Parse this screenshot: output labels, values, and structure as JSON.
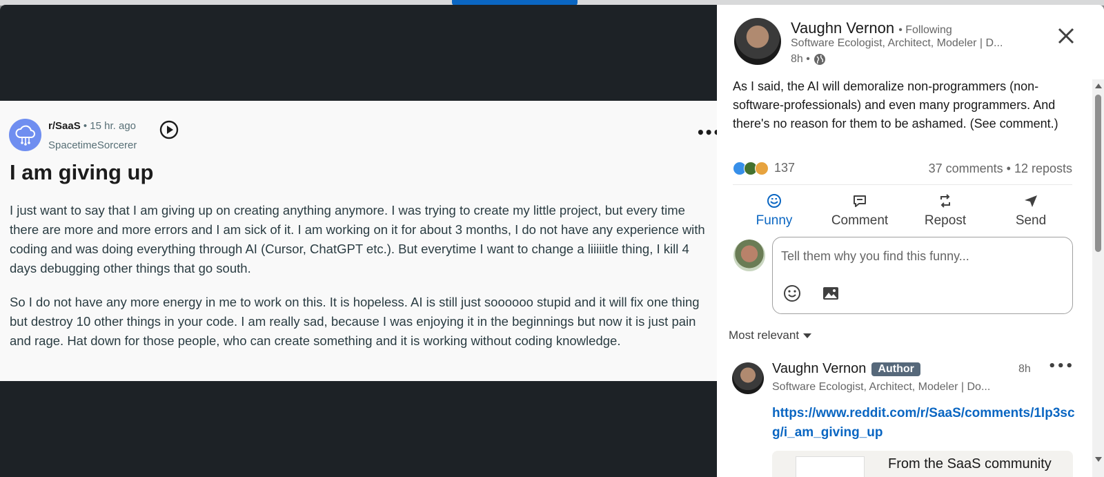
{
  "reddit_post": {
    "subreddit": "r/SaaS",
    "time": "• 15 hr. ago",
    "username": "SpacetimeSorcerer",
    "title": "I am giving up",
    "paragraph_1": "I just want to say that I am giving up on creating anything anymore. I was trying to create my little project, but every time there are more and more errors and I am sick of it. I am working on it for about 3 months, I do not have any experience with coding and was doing everything through AI (Cursor, ChatGPT etc.). But everytime I want to change a liiiiitle thing, I kill 4 days debugging other things that go south.",
    "paragraph_2": "So I do not have any more energy in me to work on this. It is hopeless. AI is still just soooooo stupid and it will fix one thing but destroy 10 other things in your code. I am really sad, because I was enjoying it in the beginnings but now it is just pain and rage. Hat down for those people, who can create something and it is working without coding knowledge."
  },
  "linkedin_post": {
    "author_name": "Vaughn Vernon",
    "follow_status": "• Following",
    "headline": "Software Ecologist, Architect, Modeler | D...",
    "time": "8h •",
    "text": "As I said, the AI will demoralize non-programmers (non-software-professionals) and even many programmers. And there's no reason for them to be ashamed. (See comment.)",
    "reaction_count": "137",
    "stats": "37 comments • 12 reposts",
    "actions": {
      "funny": "Funny",
      "comment": "Comment",
      "repost": "Repost",
      "send": "Send"
    },
    "comment_placeholder": "Tell them why you find this funny...",
    "sort_label": "Most relevant"
  },
  "top_comment": {
    "author": "Vaughn Vernon",
    "badge": "Author",
    "time": "8h",
    "headline": "Software Ecologist, Architect, Modeler | Do...",
    "link": "https://www.reddit.com/r/SaaS/comments/1lp3scg/i_am_giving_up",
    "preview_title": "From the SaaS community"
  },
  "colors": {
    "linkedin_blue": "#0a66c2",
    "dark_backdrop": "#1d2226",
    "reddit_avatar": "#6f8ef0",
    "author_badge": "#56687a"
  }
}
